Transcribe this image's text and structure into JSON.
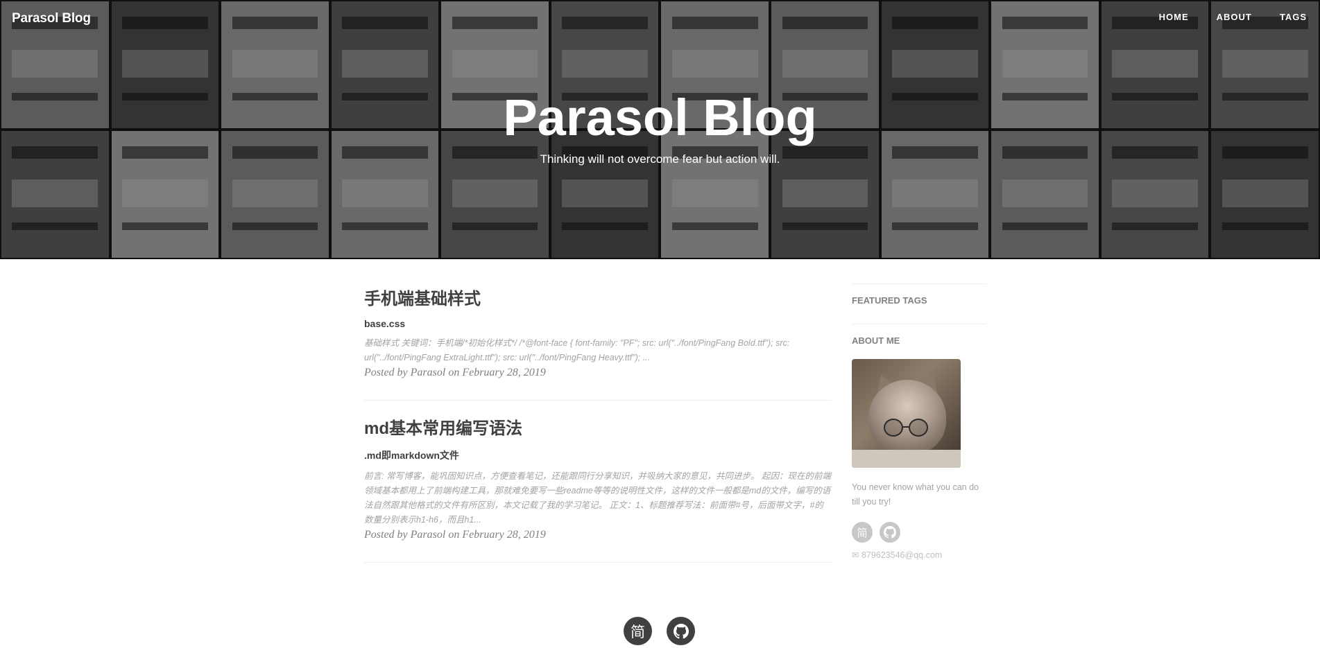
{
  "nav": {
    "brand": "Parasol Blog",
    "links": [
      "HOME",
      "ABOUT",
      "TAGS"
    ]
  },
  "hero": {
    "title": "Parasol Blog",
    "subtitle": "Thinking will not overcome fear but action will."
  },
  "posts": [
    {
      "title": "手机端基础样式",
      "subtitle": "base.css",
      "excerpt": "基础样式 关键词：手机端/*初始化样式*/ /*@font-face { font-family: \"PF\"; src: url(\"../font/PingFang Bold.ttf\"); src: url(\"../font/PingFang ExtraLight.ttf\"); src: url(\"../font/PingFang Heavy.ttf\"); ...",
      "meta": "Posted by Parasol on February 28, 2019"
    },
    {
      "title": "md基本常用编写语法",
      "subtitle": ".md即markdown文件",
      "excerpt": "前言: 常写博客，能巩固知识点，方便查看笔记，还能跟同行分享知识，并吸纳大家的意见，共同进步。 起因：现在的前端领域基本都用上了前端构建工具，那就难免要写一些readme等等的说明性文件，这样的文件一般都是md的文件，编写的语法自然跟其他格式的文件有所区别，本文记载了我的学习笔记。 正文：1、标题推荐写法：前面带#号，后面带文字，#的数量分别表示h1-h6，而且h1...",
      "meta": "Posted by Parasol on February 28, 2019"
    }
  ],
  "sidebar": {
    "featured_tags_heading": "FEATURED TAGS",
    "about_heading": "ABOUT ME",
    "about_text": "You never know what you can do till you try!",
    "jianshu_glyph": "简",
    "email": "✉ 879623546@qq.com"
  },
  "footer": {
    "jianshu_glyph": "简"
  },
  "icons": {
    "jianshu": "jianshu-icon",
    "github": "github-icon",
    "email": "envelope-icon"
  }
}
